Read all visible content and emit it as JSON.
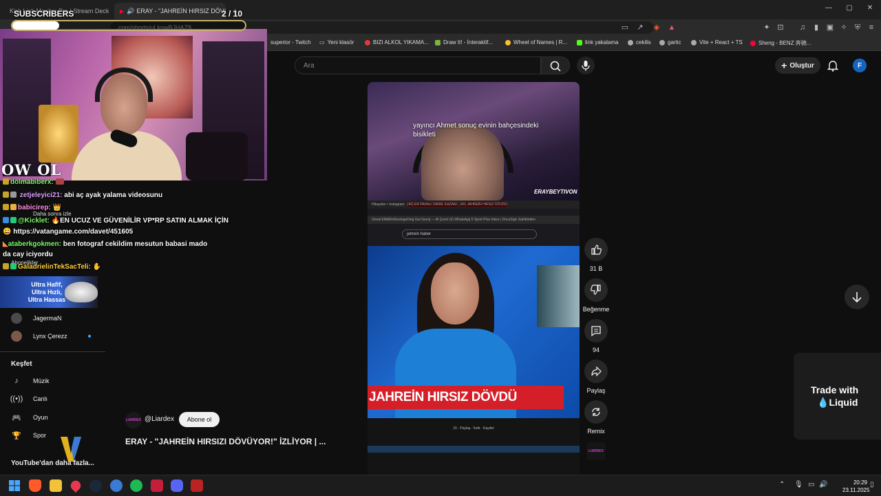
{
  "browser": {
    "tabs": [
      {
        "label": "Kick Link Monitor Pro | Stream Deck"
      },
      {
        "label": "ERAY - \"JAHREİN HIRSIZ DÖV"
      }
    ],
    "tab_close": "×",
    "new_tab": "+",
    "window_controls": {
      "minimize": "—",
      "maximize": "▢",
      "close": "✕"
    },
    "url": "com/shorts/uLkowBJHAZ8",
    "url_prefix_hint": "ERAY - \"JAHREİN HIRSIZ",
    "bookmarks": [
      {
        "label": "superior - Twitch",
        "color": "#9146ff"
      },
      {
        "label": "Yeni klasör",
        "color": "#888888"
      },
      {
        "label": "BIZI ALKOL YIKAMA...",
        "color": "#e53935"
      },
      {
        "label": "Draw It! - İnteraktif...",
        "color": "#7cb342"
      },
      {
        "label": "Wheel of Names | R...",
        "color": "#fbc02d"
      },
      {
        "label": "link yakalama",
        "color": "#53fc18"
      },
      {
        "label": "cekilis",
        "color": "#aaaaaa"
      },
      {
        "label": "gartic",
        "color": "#aaaaaa"
      },
      {
        "label": "Vite + React + TS",
        "color": "#aaaaaa"
      },
      {
        "label": "Sheng - BENZ 奔驰...",
        "color": "#ff0033"
      }
    ]
  },
  "youtube": {
    "search_placeholder": "Ara",
    "create_label": "Oluştur",
    "avatar_letter": "F",
    "video": {
      "caption": "yayıncı Ahmet sonuç evinin bahçesindeki bisikleti",
      "watermark": "ERAYBEYTIVON",
      "inner_search": "jahrein haber",
      "headline": "JAHREİN HIRSIZ DÖVDÜ",
      "inner_tabs": [
        "Hikayeler • Instagram",
        "(40) EN PAHALI DAİRE KAZANI",
        "(40) JAHREİN HIRSIZ DÖVDÜ"
      ],
      "inner_bookmarks": "Gmail  EMARelSoologeDing  Get Gecoj — Al  Çeviri  (2) WhatsApp  5 Sport Plus  Inbox | DocuSign  Sahibinden",
      "inner_actions": "15   ·   Paylaş   ·   İndir   ·   Kaydet"
    },
    "actions": [
      {
        "icon": "like",
        "label": "31 B"
      },
      {
        "icon": "dislike",
        "label": "Beğenme"
      },
      {
        "icon": "comment",
        "label": "94"
      },
      {
        "icon": "share",
        "label": "Paylaş"
      },
      {
        "icon": "remix",
        "label": "Remix"
      }
    ],
    "channel_thumb_text": "LIARDEX",
    "channel": {
      "avatar_text": "LIARDEX",
      "name": "@Liardex",
      "subscribe": "Abone ol"
    },
    "video_title": "ERAY - \"JAHREİN HIRSIZI DÖVÜYOR!\" İZLİYOR | ...",
    "ad": {
      "line1": "Trade with",
      "line2": "Liquid"
    },
    "sidebar": {
      "subs": [
        {
          "name": "JagermaN"
        },
        {
          "name": "Lynx Çerezz"
        }
      ],
      "explore_title": "Keşfet",
      "explore": [
        {
          "label": "Müzik",
          "icon": "music-icon"
        },
        {
          "label": "Canlı",
          "icon": "live-icon"
        },
        {
          "label": "Oyun",
          "icon": "gaming-icon"
        },
        {
          "label": "Spor",
          "icon": "sports-icon"
        }
      ],
      "more": "YouTube'dan daha fazla...",
      "hidden_watch_later": "Daha sonra izle",
      "hidden_subscriptions": "Abonelikler"
    }
  },
  "overlay": {
    "subs_label": "SUBSCRIBERS",
    "subs_count": "2 / 10",
    "subs_progress": 0.2,
    "logo": "OW OL",
    "chat": [
      {
        "user": "dolmabiberx:",
        "msg": "",
        "color": "#7cfc6a"
      },
      {
        "user": "zetjeleyici21:",
        "msg": "abi aç ayak yalama videosunu",
        "color": "#e0a0ff"
      },
      {
        "user": "babicirep:",
        "msg": "",
        "color": "#ff8fe0"
      },
      {
        "user": "@Kicklet:",
        "msg": "EN UCUZ VE GÜVENİLİR VP*RP SATIN ALMAK İÇİN",
        "color": "#7cfc6a"
      },
      {
        "user": "",
        "msg": "https://vatangame.com/davet/451605",
        "color": "#ffffff"
      },
      {
        "user": "ataberkgokmen:",
        "msg": "ben fotograf cekildim mesutun babasi mado",
        "color": "#7cfc6a"
      },
      {
        "user": "",
        "msg": "da cay iciyordu",
        "color": "#ffffff"
      },
      {
        "user": "GaladrielinTekSacTeli:",
        "msg": "",
        "color": "#ffd23f"
      }
    ],
    "banner": {
      "l1": "Ultra Hafif,",
      "l2": "Ultra Hızlı,",
      "l3": "Ultra Hassas"
    }
  },
  "taskbar": {
    "time": "20:29",
    "date": "23.11.2025",
    "apps": [
      "start",
      "brave",
      "files",
      "maps",
      "steam",
      "edge",
      "spotify",
      "app-red",
      "discord",
      "news"
    ]
  }
}
